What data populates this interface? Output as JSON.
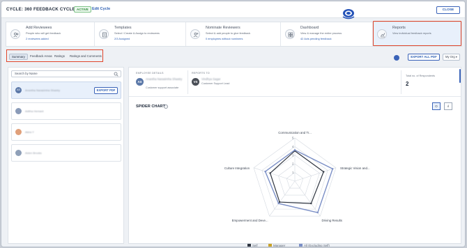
{
  "header": {
    "cycle_title": "CYCLE: 360 FEEDBACK CYCLE 2025",
    "status_badge": "ACTIVE",
    "edit_link": "Edit Cycle",
    "close_label": "CLOSE"
  },
  "steps": [
    {
      "title": "Add Reviewees",
      "subtitle": "People who will get feedback",
      "link": "2 reviewees added",
      "icon": "users-icon"
    },
    {
      "title": "Templates",
      "subtitle": "Select / Create & Assign to reviewees",
      "link": "2/3 Assigned",
      "icon": "template-icon"
    },
    {
      "title": "Nominate Reviewers",
      "subtitle": "Select & add people to give feedback",
      "link": "0 employees without nominees",
      "icon": "nominate-icon"
    },
    {
      "title": "Dashboard",
      "subtitle": "View & manage the entire process",
      "link": "42 Acts pending feedback",
      "icon": "dashboard-icon"
    },
    {
      "title": "Reports",
      "subtitle": "View individual feedback reports",
      "link": "",
      "icon": "chart-icon"
    }
  ],
  "tabs": [
    "Summary",
    "Feedback Areas",
    "Ratings",
    "Ratings and Comments"
  ],
  "toolbar": {
    "export_all": "EXPORT ALL PDF",
    "scope_select": "My Org"
  },
  "left_panel": {
    "search_placeholder": "Search by Name",
    "employees": [
      {
        "initials": "AS",
        "name": "Anantha Narasimha Shastry",
        "avatar_color": "#5b78a8",
        "export_label": "EXPORT PDF"
      },
      {
        "initials": "",
        "name": "Aditha Hemant",
        "avatar_color": "#8a9bb8"
      },
      {
        "initials": "",
        "name": "Akira Y",
        "avatar_color": "#e0a07a"
      },
      {
        "initials": "",
        "name": "Aiden Brooks",
        "avatar_color": "#8fa0b8"
      }
    ]
  },
  "details": {
    "employee_label": "EMPLOYEE DETAILS",
    "employee_initials": "AS",
    "employee_name": "Anantha Narasimha Shastry",
    "employee_role": "Customer support associate",
    "reports_label": "REPORTS TO",
    "manager_initials": "VS",
    "manager_name": "Vindhya Sagar",
    "manager_role": "Customer Support Lead",
    "total_label": "Total no. of Respondents",
    "total_value": "2"
  },
  "chart_section": {
    "title": "SPIDER CHART",
    "view_buttons": [
      "O",
      "ıl"
    ]
  },
  "chart_data": {
    "type": "radar",
    "categories": [
      "Communication and Tr...",
      "Strategic Vision and...",
      "Driving Results",
      "Empowerment and Deve...",
      "Culture Integration"
    ],
    "rlim": [
      0,
      5
    ],
    "ticks": [
      1,
      2,
      3,
      4,
      5
    ],
    "series": [
      {
        "name": "Self",
        "color": "#2f3540",
        "values": [
          3.5,
          3.5,
          3.2,
          3.0,
          3.0
        ]
      },
      {
        "name": "Manager",
        "color": "#c9a227",
        "values": []
      },
      {
        "name": "All (Excluding Self)",
        "color": "#7b8fc6",
        "values": [
          3.6,
          4.6,
          4.5,
          3.2,
          3.6
        ]
      }
    ]
  }
}
